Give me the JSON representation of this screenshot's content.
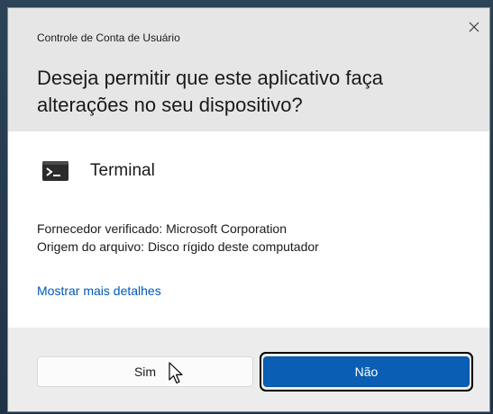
{
  "dialog": {
    "window_title": "Controle de Conta de Usuário",
    "question": "Deseja permitir que este aplicativo faça alterações no seu dispositivo?",
    "app_name": "Terminal",
    "publisher": "Fornecedor verificado: Microsoft Corporation",
    "origin": "Origem do arquivo: Disco rígido deste computador",
    "details_link": "Mostrar mais detalhes",
    "yes_label": "Sim",
    "no_label": "Não",
    "close_icon": "close-icon",
    "app_icon": "terminal-icon"
  },
  "colors": {
    "header_bg": "#e6e6e6",
    "footer_bg": "#ececec",
    "accent": "#0a5fb4",
    "link": "#0059b3"
  }
}
